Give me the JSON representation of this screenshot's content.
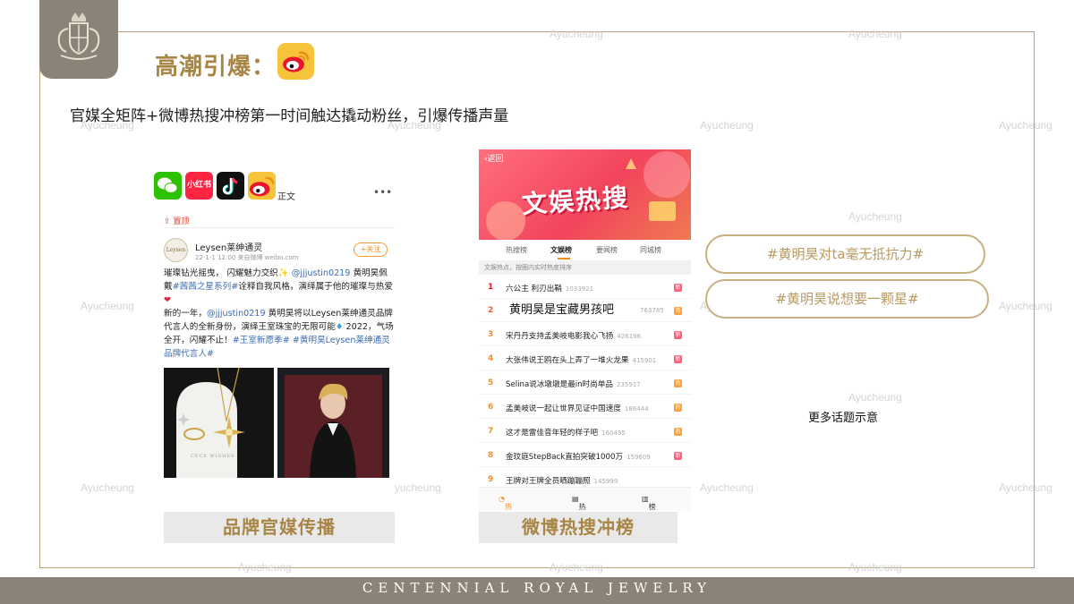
{
  "title": "高潮引爆：",
  "subtitle": "官媒全矩阵+微博热搜冲榜第一时间触达撬动粉丝，引爆传播声量",
  "watermark": "Ayucheung",
  "footer": "CENTENNIAL   ROYAL   JEWELRY",
  "left_phone": {
    "apps": [
      "微信",
      "小红书",
      "抖音",
      "微博"
    ],
    "topbar_label": "正文",
    "pin_label": "置顶",
    "author": "Leysen莱绅通灵",
    "avatar_text": "Leysen",
    "meta": "22-1-1 12:00  来自微博 weibo.com",
    "follow": "+关注",
    "post_p1": "璀璨钻光摇曳， 闪耀魅力交织",
    "post_mention1": "@jjjustin0219",
    "post_p2": "黄明昊佩戴",
    "post_tag1": "#茜茜之星系列#",
    "post_p3": "诠释自我风格，演绎属于他的璀璨与热爱",
    "post_p4": "新的一年，",
    "post_mention2": "@jjjustin0219",
    "post_p5": "黄明昊将以Leysen莱绅通灵品牌代言人的全新身份，演绎王室珠宝的无限可能",
    "post_p6": "2022，气场全开，闪耀不止！",
    "post_tag2": "#王室新愿季# #黄明昊Leysen莱绅通灵品牌代言人#",
    "img1_text": "CECE WISHES"
  },
  "left_caption": "品牌官媒传播",
  "right_phone": {
    "back": "返回",
    "banner_title": "文娱热搜",
    "tabs": [
      "热搜榜",
      "文娱榜",
      "要闻榜",
      "同城榜"
    ],
    "desc": "文娱热点，按圈内实时热度排序",
    "rows": [
      {
        "rank": "1",
        "text": "六公主 利刃出鞘",
        "num": "1033921",
        "badge": "新"
      },
      {
        "rank": "2",
        "text": "黄明昊是宝藏男孩吧",
        "num": "763785",
        "badge": "热"
      },
      {
        "rank": "3",
        "text": "宋丹丹支持孟美岐电影我心飞扬",
        "num": "426196",
        "badge": "新"
      },
      {
        "rank": "4",
        "text": "大张伟说王鸥在头上弄了一堆火龙果",
        "num": "415901",
        "badge": "新"
      },
      {
        "rank": "5",
        "text": "Selina说冰墩墩是最in时尚单品",
        "num": "235917",
        "badge": "热"
      },
      {
        "rank": "6",
        "text": "孟美岐说一起让世界见证中国速度",
        "num": "186444",
        "badge": "热"
      },
      {
        "rank": "7",
        "text": "这才是雷佳音年轻的样子吧",
        "num": "160495",
        "badge": "热"
      },
      {
        "rank": "8",
        "text": "金玟庭StepBack直拍突破1000万",
        "num": "159609",
        "badge": "新"
      },
      {
        "rank": "9",
        "text": "王牌对王牌全员晒蹦蹦照",
        "num": "145999",
        "badge": ""
      }
    ],
    "bottom": [
      "热搜",
      "热议",
      "榜单"
    ]
  },
  "right_caption": "微博热搜冲榜",
  "topics": [
    "#黄明昊对ta毫无抵抗力#",
    "#黄明昊说想要一颗星#"
  ],
  "more_topics": "更多话题示意",
  "colors": {
    "gold": "#a88545",
    "frame": "#b8a27a",
    "footer": "#8a8478",
    "weibo_orange": "#f28d2d"
  }
}
